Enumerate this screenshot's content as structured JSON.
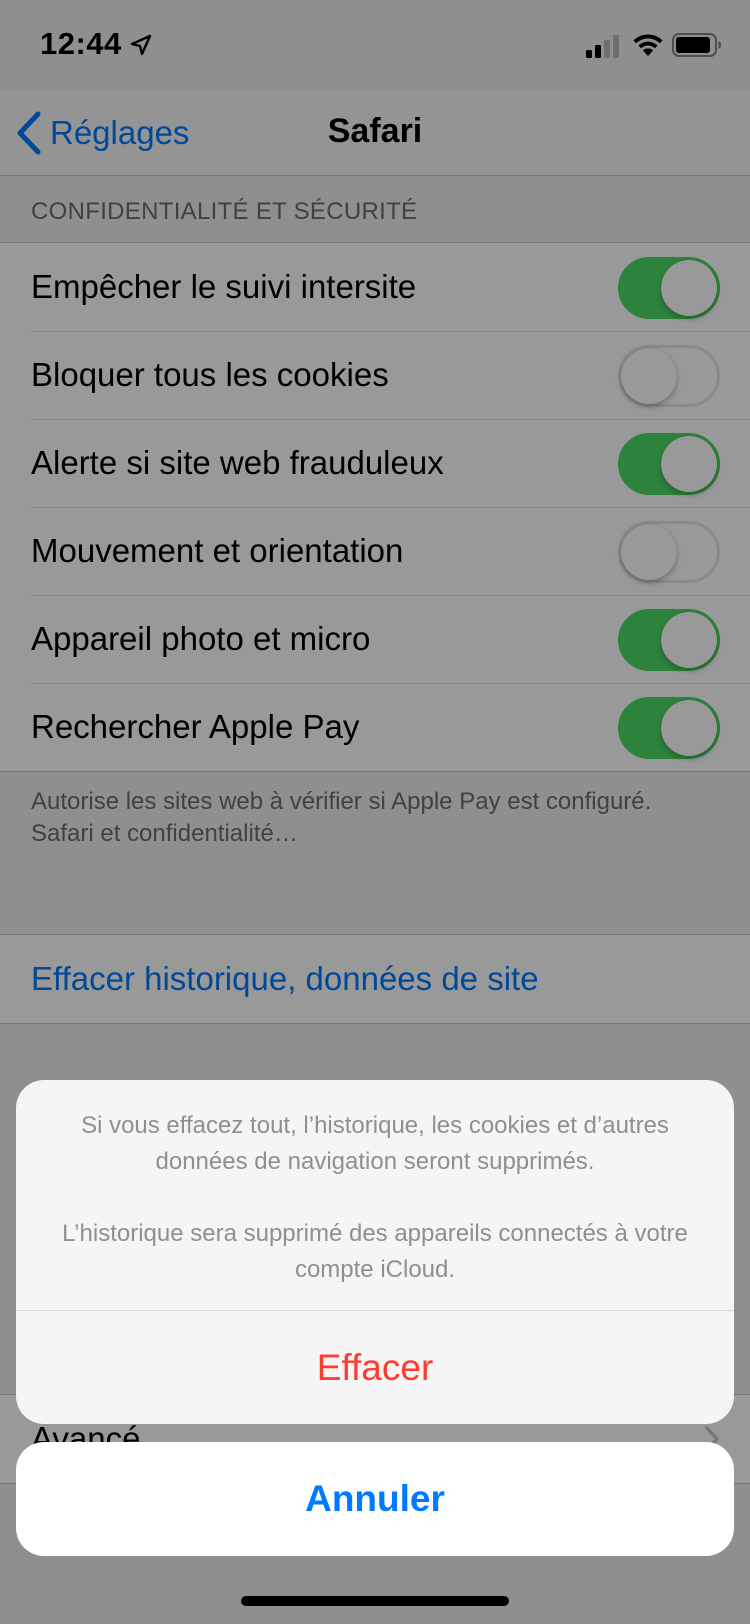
{
  "status_bar": {
    "time": "12:44",
    "icons": [
      "location-arrow-icon",
      "cellular-signal-icon",
      "wifi-icon",
      "battery-icon"
    ]
  },
  "nav": {
    "back_label": "Réglages",
    "title": "Safari"
  },
  "privacy_section": {
    "header": "CONFIDENTIALITÉ ET SÉCURITÉ",
    "rows": [
      {
        "label": "Empêcher le suivi intersite",
        "on": true
      },
      {
        "label": "Bloquer tous les cookies",
        "on": false
      },
      {
        "label": "Alerte si site web frauduleux",
        "on": true
      },
      {
        "label": "Mouvement et orientation",
        "on": false
      },
      {
        "label": "Appareil photo et micro",
        "on": true
      },
      {
        "label": "Rechercher Apple Pay",
        "on": true
      }
    ],
    "footer_text": "Autorise les sites web à vérifier si Apple Pay est configuré.",
    "footer_link": "Safari et confidentialité…"
  },
  "clear_history": {
    "label": "Effacer historique, données de site"
  },
  "advanced": {
    "label": "Avancé"
  },
  "action_sheet": {
    "message_1": "Si vous effacez tout, l’historique, les cookies et d’autres données de navigation seront supprimés.",
    "message_2": "L’historique sera supprimé des appareils connectés à votre compte iCloud.",
    "destructive_label": "Effacer",
    "cancel_label": "Annuler"
  },
  "colors": {
    "accent": "#007aff",
    "destructive": "#ff3b30",
    "toggle_on": "#4cd964"
  }
}
